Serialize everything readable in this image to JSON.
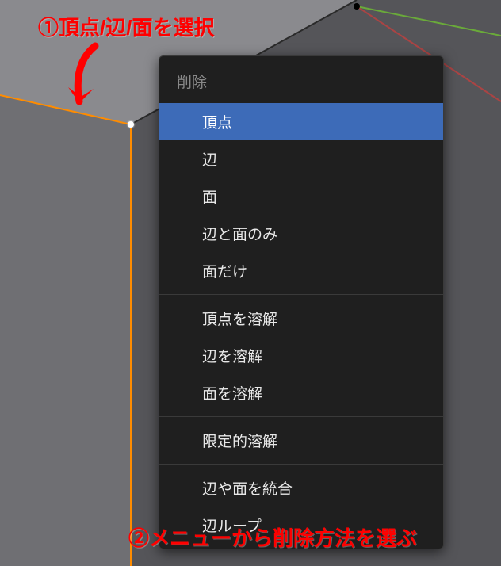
{
  "annotations": {
    "step1": "①頂点/辺/面を選択",
    "step2": "②メニューから削除方法を選ぶ"
  },
  "menu": {
    "title": "削除",
    "groups": [
      [
        {
          "label": "頂点",
          "highlighted": true
        },
        {
          "label": "辺",
          "highlighted": false
        },
        {
          "label": "面",
          "highlighted": false
        },
        {
          "label": "辺と面のみ",
          "highlighted": false
        },
        {
          "label": "面だけ",
          "highlighted": false
        }
      ],
      [
        {
          "label": "頂点を溶解",
          "highlighted": false
        },
        {
          "label": "辺を溶解",
          "highlighted": false
        },
        {
          "label": "面を溶解",
          "highlighted": false
        }
      ],
      [
        {
          "label": "限定的溶解",
          "highlighted": false
        }
      ],
      [
        {
          "label": "辺や面を統合",
          "highlighted": false
        },
        {
          "label": "辺ループ",
          "highlighted": false
        }
      ]
    ]
  },
  "viewport": {
    "vertex_selected_color": "#ffffff",
    "vertex_color": "#000000",
    "edge_selected_color": "#ff8c00",
    "axis_x_color": "#aa4444",
    "axis_y_color": "#6aaa3a"
  }
}
